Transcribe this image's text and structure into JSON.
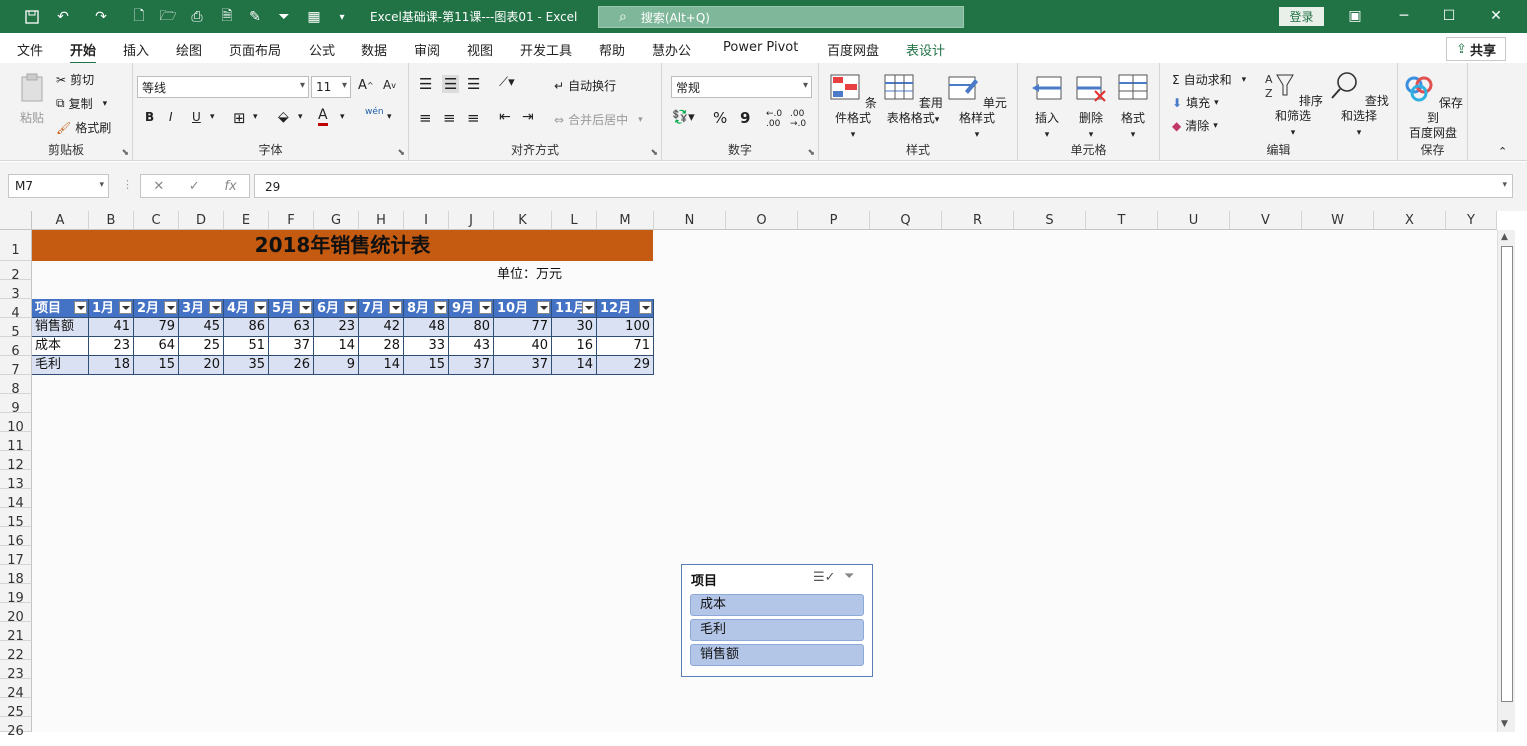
{
  "titlebar": {
    "doc_title": "Excel基础课-第11课---图表01 - Excel",
    "search_placeholder": "搜索(Alt+Q)",
    "login": "登录"
  },
  "tabs": [
    "文件",
    "开始",
    "插入",
    "绘图",
    "页面布局",
    "公式",
    "数据",
    "审阅",
    "视图",
    "开发工具",
    "帮助",
    "慧办公",
    "Power Pivot",
    "百度网盘",
    "表设计"
  ],
  "active_tab": "开始",
  "share_label": "共享",
  "ribbon": {
    "clipboard": {
      "label": "剪贴板",
      "paste": "粘贴",
      "cut": "剪切",
      "copy": "复制",
      "painter": "格式刷"
    },
    "font": {
      "label": "字体",
      "font_name": "等线",
      "font_size": "11",
      "bold": "B",
      "italic": "I",
      "underline": "U",
      "fill_letter": "A",
      "wen": "wén"
    },
    "align": {
      "label": "对齐方式",
      "wrap": "自动换行",
      "merge": "合并后居中"
    },
    "number": {
      "label": "数字",
      "format": "常规",
      "percent": "%",
      "comma": "9"
    },
    "styles": {
      "label": "样式",
      "cond": "条件格式",
      "table_fmt_1": "套用",
      "table_fmt_2": "表格格式",
      "cell_style": "单元格样式"
    },
    "cells": {
      "label": "单元格",
      "insert": "插入",
      "delete": "删除",
      "format": "格式"
    },
    "edit": {
      "label": "编辑",
      "autosum": "自动求和",
      "fill": "填充",
      "clear": "清除",
      "sort": "排序和筛选",
      "find": "查找和选择"
    },
    "save": {
      "label": "保存",
      "line1": "保存到",
      "line2": "百度网盘"
    }
  },
  "formula_bar": {
    "name_box": "M7",
    "value": "29",
    "fx": "fx"
  },
  "columns": [
    "A",
    "B",
    "C",
    "D",
    "E",
    "F",
    "G",
    "H",
    "I",
    "J",
    "K",
    "L",
    "M",
    "N",
    "O",
    "P",
    "Q",
    "R",
    "S",
    "T",
    "U",
    "V",
    "W",
    "X",
    "Y"
  ],
  "rows": [
    "1",
    "2",
    "3",
    "4",
    "5",
    "6",
    "7",
    "8",
    "9",
    "10",
    "11",
    "12",
    "13",
    "14",
    "15",
    "16",
    "17",
    "18",
    "19",
    "20",
    "21",
    "22",
    "23",
    "24",
    "25",
    "26"
  ],
  "sheet": {
    "title": "2018年销售统计表",
    "unit": "单位：万元",
    "headers": [
      "项目",
      "1月",
      "2月",
      "3月",
      "4月",
      "5月",
      "6月",
      "7月",
      "8月",
      "9月",
      "10月",
      "11月",
      "12月"
    ],
    "rows": [
      {
        "label": "销售额",
        "values": [
          "41",
          "79",
          "45",
          "86",
          "63",
          "23",
          "42",
          "48",
          "80",
          "77",
          "30",
          "100"
        ]
      },
      {
        "label": "成本",
        "values": [
          "23",
          "64",
          "25",
          "51",
          "37",
          "14",
          "28",
          "33",
          "43",
          "40",
          "16",
          "71"
        ]
      },
      {
        "label": "毛利",
        "values": [
          "18",
          "15",
          "20",
          "35",
          "26",
          "9",
          "14",
          "15",
          "37",
          "37",
          "14",
          "29"
        ]
      }
    ]
  },
  "slicer": {
    "title": "项目",
    "items": [
      "成本",
      "毛利",
      "销售额"
    ]
  },
  "colors": {
    "excel_green": "#217346",
    "title_fill": "#c55a11",
    "table_header": "#4472c4",
    "table_band": "#d9e1f2",
    "slicer_item": "#b4c6e7"
  }
}
